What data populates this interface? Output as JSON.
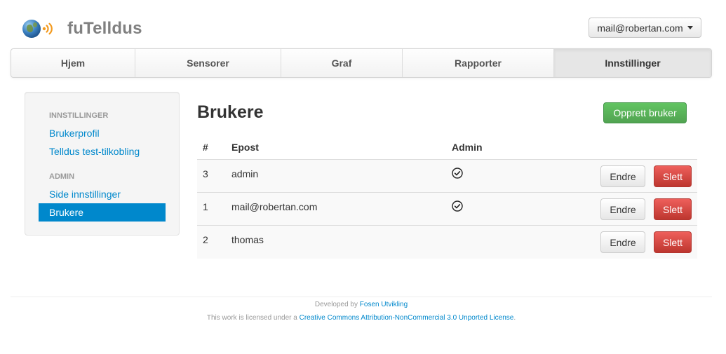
{
  "header": {
    "app_title": "fuTelldus",
    "user_menu_label": "mail@robertan.com"
  },
  "nav": {
    "items": [
      {
        "label": "Hjem",
        "active": false
      },
      {
        "label": "Sensorer",
        "active": false
      },
      {
        "label": "Graf",
        "active": false
      },
      {
        "label": "Rapporter",
        "active": false
      },
      {
        "label": "Innstillinger",
        "active": true
      }
    ]
  },
  "sidebar": {
    "sections": [
      {
        "header": "INNSTILLINGER",
        "items": [
          "Brukerprofil",
          "Telldus test-tilkobling"
        ]
      },
      {
        "header": "ADMIN",
        "items": [
          "Side innstillinger",
          "Brukere"
        ]
      }
    ],
    "active_item": "Brukere"
  },
  "main": {
    "title": "Brukere",
    "create_button": "Opprett bruker",
    "table": {
      "columns": [
        "#",
        "Epost",
        "Admin"
      ],
      "rows": [
        {
          "id": "3",
          "email": "admin",
          "admin": true
        },
        {
          "id": "1",
          "email": "mail@robertan.com",
          "admin": true
        },
        {
          "id": "2",
          "email": "thomas",
          "admin": false
        }
      ],
      "edit_label": "Endre",
      "delete_label": "Slett"
    }
  },
  "footer": {
    "developed_prefix": "Developed by",
    "developer": "Fosen Utvikling",
    "license_prefix": "This work is licensed under a",
    "license_link": "Creative Commons Attribution-NonCommercial 3.0 Unported License",
    "license_suffix": "."
  },
  "colors": {
    "link": "#0088cc",
    "success": "#51a351",
    "danger": "#bd362f",
    "logo_wave": "#f39a1e"
  }
}
